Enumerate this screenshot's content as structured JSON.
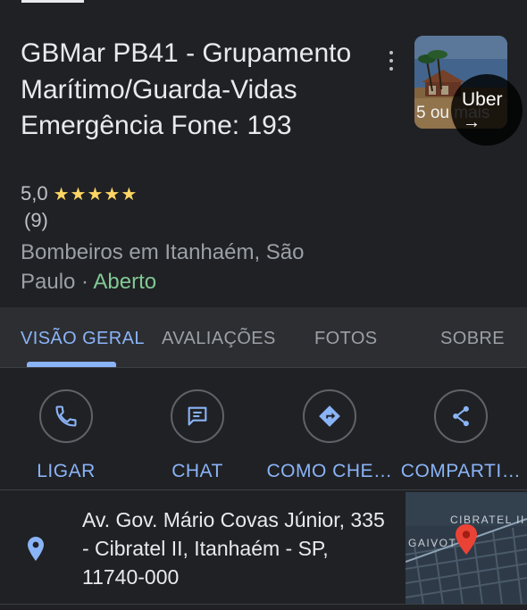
{
  "place": {
    "title": "GBMar PB41 - Grupamento Marítimo/Guarda-Vidas Emergência Fone: 193",
    "rating": "5,0",
    "stars": "★★★★★",
    "review_count": "(9)",
    "category": "Bombeiros em Itanhaém, São Paulo",
    "separator": " · ",
    "status": "Aberto"
  },
  "thumbnail": {
    "more_photos": "5 ou mais",
    "uber_label": "Uber",
    "uber_arrow": "→"
  },
  "tabs": [
    {
      "label": "VISÃO GERAL",
      "active": true
    },
    {
      "label": "AVALIAÇÕES",
      "active": false
    },
    {
      "label": "FOTOS",
      "active": false
    },
    {
      "label": "SOBRE",
      "active": false
    }
  ],
  "actions": [
    {
      "label": "LIGAR",
      "icon": "phone-icon"
    },
    {
      "label": "CHAT",
      "icon": "chat-icon"
    },
    {
      "label": "COMO CHE…",
      "icon": "directions-icon"
    },
    {
      "label": "COMPARTI…",
      "icon": "share-icon"
    }
  ],
  "address": {
    "text": "Av. Gov. Mário Covas Júnior, 335 - Cibratel II, Itanhaém - SP, 11740-000",
    "icon": "location-pin-icon"
  },
  "map": {
    "label_1": "CIBRATEL II",
    "label_2": "GAIVOT"
  },
  "colors": {
    "background": "#202124",
    "accent_blue": "#8ab4f8",
    "open_green": "#81c995",
    "star_yellow": "#fdd663",
    "map_pin_red": "#ea4335"
  }
}
